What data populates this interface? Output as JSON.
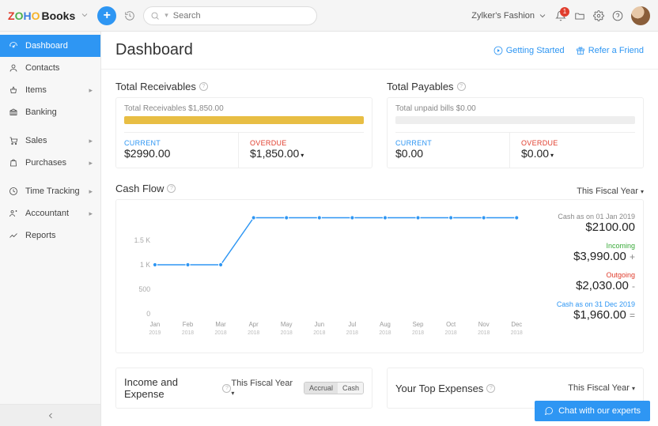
{
  "header": {
    "brand": "Books",
    "search_placeholder": "Search",
    "org_name": "Zylker's Fashion",
    "notification_count": "1"
  },
  "sidebar": {
    "items": [
      {
        "label": "Dashboard",
        "icon": "speedometer-icon",
        "expandable": false,
        "active": true
      },
      {
        "label": "Contacts",
        "icon": "user-icon",
        "expandable": false
      },
      {
        "label": "Items",
        "icon": "basket-icon",
        "expandable": true
      },
      {
        "label": "Banking",
        "icon": "bank-icon",
        "expandable": false
      },
      {
        "label": "Sales",
        "icon": "cart-icon",
        "expandable": true
      },
      {
        "label": "Purchases",
        "icon": "bag-icon",
        "expandable": true
      },
      {
        "label": "Time Tracking",
        "icon": "clock-icon",
        "expandable": true
      },
      {
        "label": "Accountant",
        "icon": "accountant-icon",
        "expandable": true
      },
      {
        "label": "Reports",
        "icon": "chart-icon",
        "expandable": false
      }
    ]
  },
  "page": {
    "title": "Dashboard",
    "getting_started": "Getting Started",
    "refer": "Refer a Friend"
  },
  "receivables": {
    "title": "Total Receivables",
    "caption": "Total Receivables $1,850.00",
    "fill_pct": 100,
    "current_label": "CURRENT",
    "current_value": "$2990.00",
    "overdue_label": "OVERDUE",
    "overdue_value": "$1,850.00"
  },
  "payables": {
    "title": "Total Payables",
    "caption": "Total unpaid bills $0.00",
    "fill_pct": 0,
    "current_label": "CURRENT",
    "current_value": "$0.00",
    "overdue_label": "OVERDUE",
    "overdue_value": "$0.00"
  },
  "cashflow": {
    "title": "Cash Flow",
    "period": "This Fiscal Year",
    "months": [
      "Jan",
      "Feb",
      "Mar",
      "Apr",
      "May",
      "Jun",
      "Jul",
      "Aug",
      "Sep",
      "Oct",
      "Nov",
      "Dec"
    ],
    "years": [
      "2019",
      "2018",
      "2018",
      "2018",
      "2018",
      "2018",
      "2018",
      "2018",
      "2018",
      "2018",
      "2018",
      "2018"
    ],
    "begin_label": "Cash as on 01 Jan 2019",
    "begin_value": "$2100.00",
    "incoming_label": "Incoming",
    "incoming_value": "$3,990.00",
    "incoming_sign": "+",
    "outgoing_label": "Outgoing",
    "outgoing_value": "$2,030.00",
    "outgoing_sign": "-",
    "end_label": "Cash as on 31 Dec 2019",
    "end_value": "$1,960.00",
    "end_sign": "="
  },
  "income_expense": {
    "title": "Income and Expense",
    "period": "This Fiscal Year",
    "seg": [
      "Accrual",
      "Cash"
    ]
  },
  "top_expenses": {
    "title": "Your Top Expenses",
    "period": "This Fiscal Year"
  },
  "chat": {
    "label": "Chat with our experts"
  },
  "chart_data": {
    "type": "line",
    "title": "Cash Flow",
    "xlabel": "",
    "ylabel": "",
    "categories": [
      "Jan",
      "Feb",
      "Mar",
      "Apr",
      "May",
      "Jun",
      "Jul",
      "Aug",
      "Sep",
      "Oct",
      "Nov",
      "Dec"
    ],
    "values": [
      1000,
      1000,
      1000,
      1960,
      1960,
      1960,
      1960,
      1960,
      1960,
      1960,
      1960,
      1960
    ],
    "ylim": [
      0,
      2000
    ],
    "yticks": [
      0,
      500,
      1000,
      1500
    ]
  }
}
